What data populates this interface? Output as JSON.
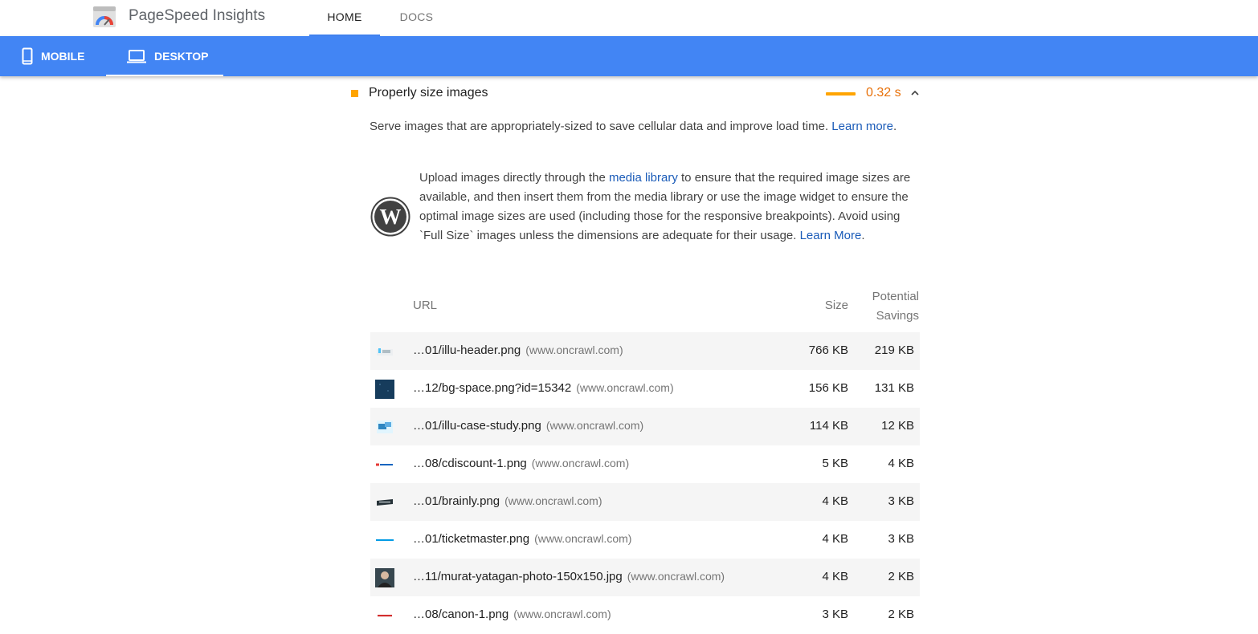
{
  "header": {
    "app_title": "PageSpeed Insights",
    "tabs": [
      {
        "label": "HOME",
        "active": true
      },
      {
        "label": "DOCS",
        "active": false
      }
    ],
    "logo_icon": "pagespeed-gauge-icon"
  },
  "device_bar": {
    "color": "#4285f4",
    "tabs": [
      {
        "label": "MOBILE",
        "icon": "phone-icon",
        "active": false
      },
      {
        "label": "DESKTOP",
        "icon": "laptop-icon",
        "active": true
      }
    ]
  },
  "audit": {
    "title": "Properly size images",
    "value": "0.32 s",
    "status_color": "#ffa400",
    "value_color": "#e8710a",
    "description_before": "Serve images that are appropriately-sized to save cellular data and improve load time. ",
    "description_link": "Learn more",
    "description_after": ".",
    "stack_pack": {
      "icon": "wordpress-icon",
      "text_1": "Upload images directly through the ",
      "link_1": "media library",
      "text_2": " to ensure that the required image sizes are available, and then insert them from the media library or use the image widget to ensure the optimal image sizes are used (including those for the responsive breakpoints). Avoid using `Full Size` images unless the dimensions are adequate for their usage. ",
      "link_2": "Learn More",
      "text_3": "."
    }
  },
  "table": {
    "headers": {
      "url": "URL",
      "size": "Size",
      "savings_line1": "Potential",
      "savings_line2": "Savings"
    },
    "rows": [
      {
        "url": "…01/illu-header.png",
        "host": "(www.oncrawl.com)",
        "size": "766 KB",
        "savings": "219 KB",
        "thumb": "illustration-thumbnail"
      },
      {
        "url": "…12/bg-space.png?id=15342",
        "host": "(www.oncrawl.com)",
        "size": "156 KB",
        "savings": "131 KB",
        "thumb": "dark-blue-thumbnail"
      },
      {
        "url": "…01/illu-case-study.png",
        "host": "(www.oncrawl.com)",
        "size": "114 KB",
        "savings": "12 KB",
        "thumb": "case-study-thumbnail"
      },
      {
        "url": "…08/cdiscount-1.png",
        "host": "(www.oncrawl.com)",
        "size": "5 KB",
        "savings": "4 KB",
        "thumb": "cdiscount-logo-thumbnail"
      },
      {
        "url": "…01/brainly.png",
        "host": "(www.oncrawl.com)",
        "size": "4 KB",
        "savings": "3 KB",
        "thumb": "brainly-logo-thumbnail"
      },
      {
        "url": "…01/ticketmaster.png",
        "host": "(www.oncrawl.com)",
        "size": "4 KB",
        "savings": "3 KB",
        "thumb": "ticketmaster-logo-thumbnail"
      },
      {
        "url": "…11/murat-yatagan-photo-150x150.jpg",
        "host": "(www.oncrawl.com)",
        "size": "4 KB",
        "savings": "2 KB",
        "thumb": "portrait-photo-thumbnail"
      },
      {
        "url": "…08/canon-1.png",
        "host": "(www.oncrawl.com)",
        "size": "3 KB",
        "savings": "2 KB",
        "thumb": "canon-logo-thumbnail"
      }
    ]
  }
}
